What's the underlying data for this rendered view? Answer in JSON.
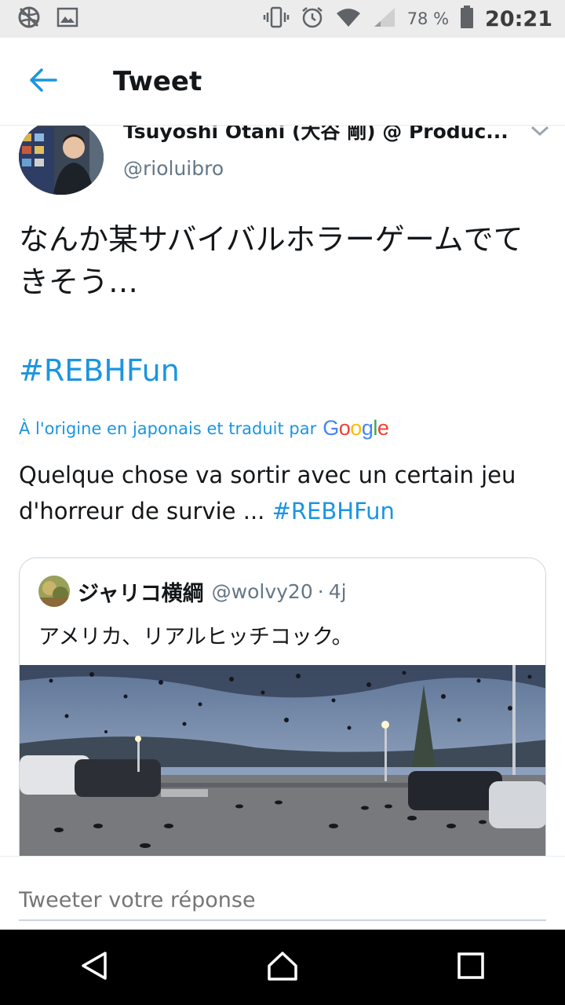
{
  "status_bar": {
    "battery_percent": "78 %",
    "time": "20:21",
    "icons": [
      "no-vpn-icon",
      "image-notification-icon",
      "vibrate-icon",
      "alarm-icon",
      "wifi-icon",
      "signal-icon",
      "battery-icon"
    ]
  },
  "header": {
    "title": "Tweet",
    "back_icon": "back-arrow-icon"
  },
  "tweet": {
    "author_name": "Tsuyoshi Otani (大谷 剛) @ Produc...",
    "author_handle": "@rioluibro",
    "text": "なんか某サバイバルホラーゲームでてきそう…",
    "hashtag": "#REBHFun",
    "translation_label": "À l'origine en japonais et traduit par",
    "translation_provider": "Google",
    "translation_text": "Quelque chose va sortir avec un certain jeu d'horreur de survie ...",
    "translation_hashtag": "#REBHFun"
  },
  "quoted_tweet": {
    "author_name": "ジャリコ横綱",
    "author_handle": "@wolvy20",
    "separator": "·",
    "time": "4j",
    "text": "アメリカ、リアルヒッチコック。"
  },
  "reply": {
    "placeholder": "Tweeter votre réponse"
  },
  "colors": {
    "accent": "#1b95e0",
    "text": "#14171a",
    "secondary": "#657786"
  }
}
